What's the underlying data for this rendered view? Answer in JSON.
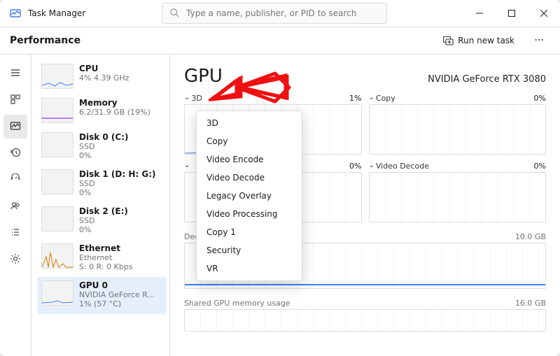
{
  "app": {
    "title": "Task Manager"
  },
  "search": {
    "placeholder": "Type a name, publisher, or PID to search"
  },
  "header": {
    "tab_title": "Performance",
    "run_task": "Run new task"
  },
  "sidebar": {
    "items": [
      {
        "name": "CPU",
        "sub": "4% 4.39 GHz",
        "sub2": ""
      },
      {
        "name": "Memory",
        "sub": "6.2/31.9 GB (19%)",
        "sub2": ""
      },
      {
        "name": "Disk 0 (C:)",
        "sub": "SSD",
        "sub2": "0%"
      },
      {
        "name": "Disk 1 (D: H: G:)",
        "sub": "SSD",
        "sub2": "0%"
      },
      {
        "name": "Disk 2 (E:)",
        "sub": "SSD",
        "sub2": "0%"
      },
      {
        "name": "Ethernet",
        "sub": "Ethernet",
        "sub2": "S: 0 R: 0 Kbps"
      },
      {
        "name": "GPU 0",
        "sub": "NVIDIA GeForce R...",
        "sub2": "1% (57 °C)"
      }
    ]
  },
  "gpu": {
    "title": "GPU",
    "name": "NVIDIA GeForce RTX 3080",
    "tiles": [
      {
        "label": "3D",
        "pct": "1%"
      },
      {
        "label": "Copy",
        "pct": "0%"
      },
      {
        "label": "",
        "pct": "0%"
      },
      {
        "label": "Video Decode",
        "pct": "0%"
      }
    ],
    "dedicated": {
      "label": "Dedicated GPU memory usage",
      "max": "10.0 GB"
    },
    "shared": {
      "label": "Shared GPU memory usage",
      "max": "16.0 GB"
    }
  },
  "dropdown": {
    "items": [
      "3D",
      "Copy",
      "Video Encode",
      "Video Decode",
      "Legacy Overlay",
      "Video Processing",
      "Copy 1",
      "Security",
      "VR"
    ]
  },
  "chart_data": [
    {
      "type": "line",
      "series": [
        {
          "name": "3D",
          "values": [
            1
          ]
        }
      ],
      "ylabel": "%",
      "ylim": [
        0,
        100
      ],
      "title": "3D"
    },
    {
      "type": "line",
      "series": [
        {
          "name": "Copy",
          "values": [
            0
          ]
        }
      ],
      "ylabel": "%",
      "ylim": [
        0,
        100
      ],
      "title": "Copy"
    },
    {
      "type": "line",
      "series": [
        {
          "name": "Video Decode",
          "values": [
            0
          ]
        }
      ],
      "ylabel": "%",
      "ylim": [
        0,
        100
      ],
      "title": "Video Decode"
    },
    {
      "type": "line",
      "series": [
        {
          "name": "Dedicated GPU memory",
          "values": [
            1
          ]
        }
      ],
      "ylabel": "GB",
      "ylim": [
        0,
        10
      ],
      "title": "Dedicated GPU memory usage"
    },
    {
      "type": "line",
      "series": [
        {
          "name": "Shared GPU memory",
          "values": [
            0
          ]
        }
      ],
      "ylabel": "GB",
      "ylim": [
        0,
        16
      ],
      "title": "Shared GPU memory usage"
    }
  ]
}
